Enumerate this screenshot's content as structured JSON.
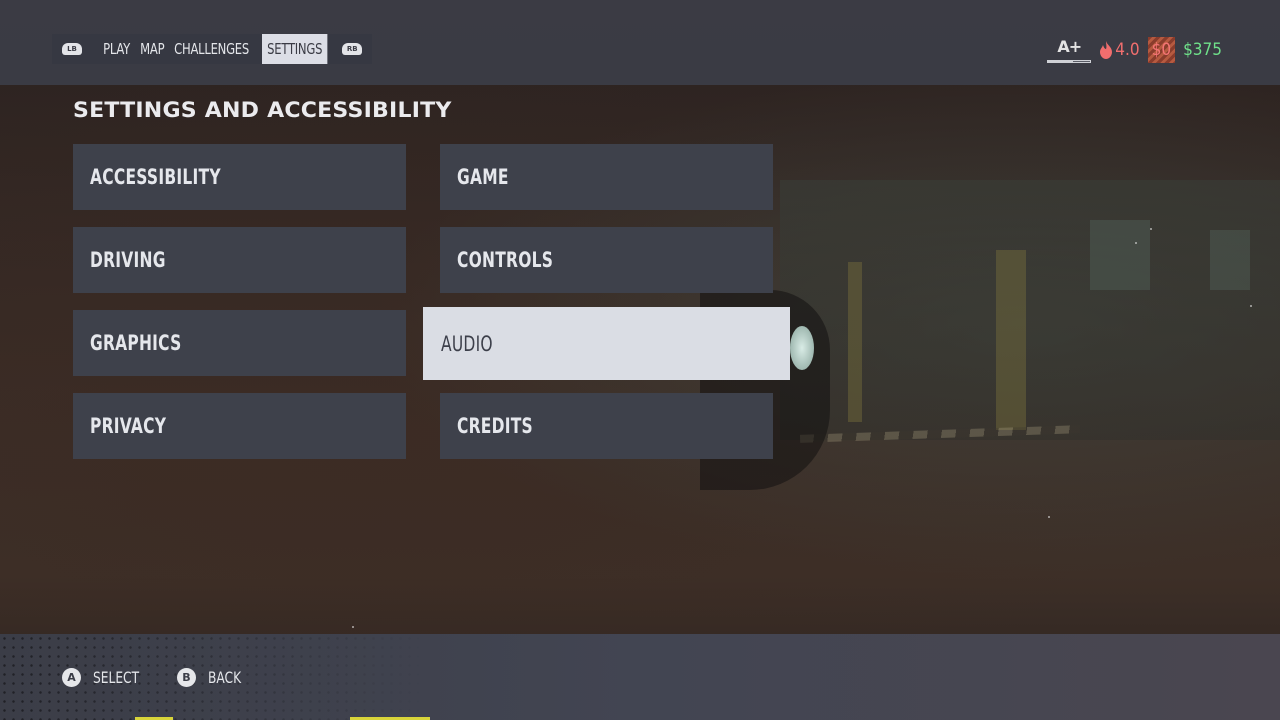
{
  "nav": {
    "left_bumper": "LB",
    "right_bumper": "RB",
    "tabs": [
      {
        "label": "PLAY",
        "active": false
      },
      {
        "label": "MAP",
        "active": false
      },
      {
        "label": "CHALLENGES",
        "active": false
      },
      {
        "label": "SETTINGS",
        "active": true
      }
    ]
  },
  "status": {
    "rank": "A+",
    "rank_progress": 0.6,
    "heat_icon": "flame-icon",
    "heat": "4.0",
    "bounty": "$0",
    "cash": "$375",
    "colors": {
      "heat": "#f06e6e",
      "bounty": "#f47474",
      "cash": "#6fe08a"
    }
  },
  "page": {
    "title": "SETTINGS AND ACCESSIBILITY"
  },
  "menu": {
    "selected": "AUDIO",
    "items": [
      {
        "label": "ACCESSIBILITY"
      },
      {
        "label": "GAME"
      },
      {
        "label": "DRIVING"
      },
      {
        "label": "CONTROLS"
      },
      {
        "label": "GRAPHICS"
      },
      {
        "label": "AUDIO"
      },
      {
        "label": "PRIVACY"
      },
      {
        "label": "CREDITS"
      }
    ]
  },
  "footer": {
    "hints": [
      {
        "button": "A",
        "label": "SELECT"
      },
      {
        "button": "B",
        "label": "BACK"
      }
    ]
  }
}
